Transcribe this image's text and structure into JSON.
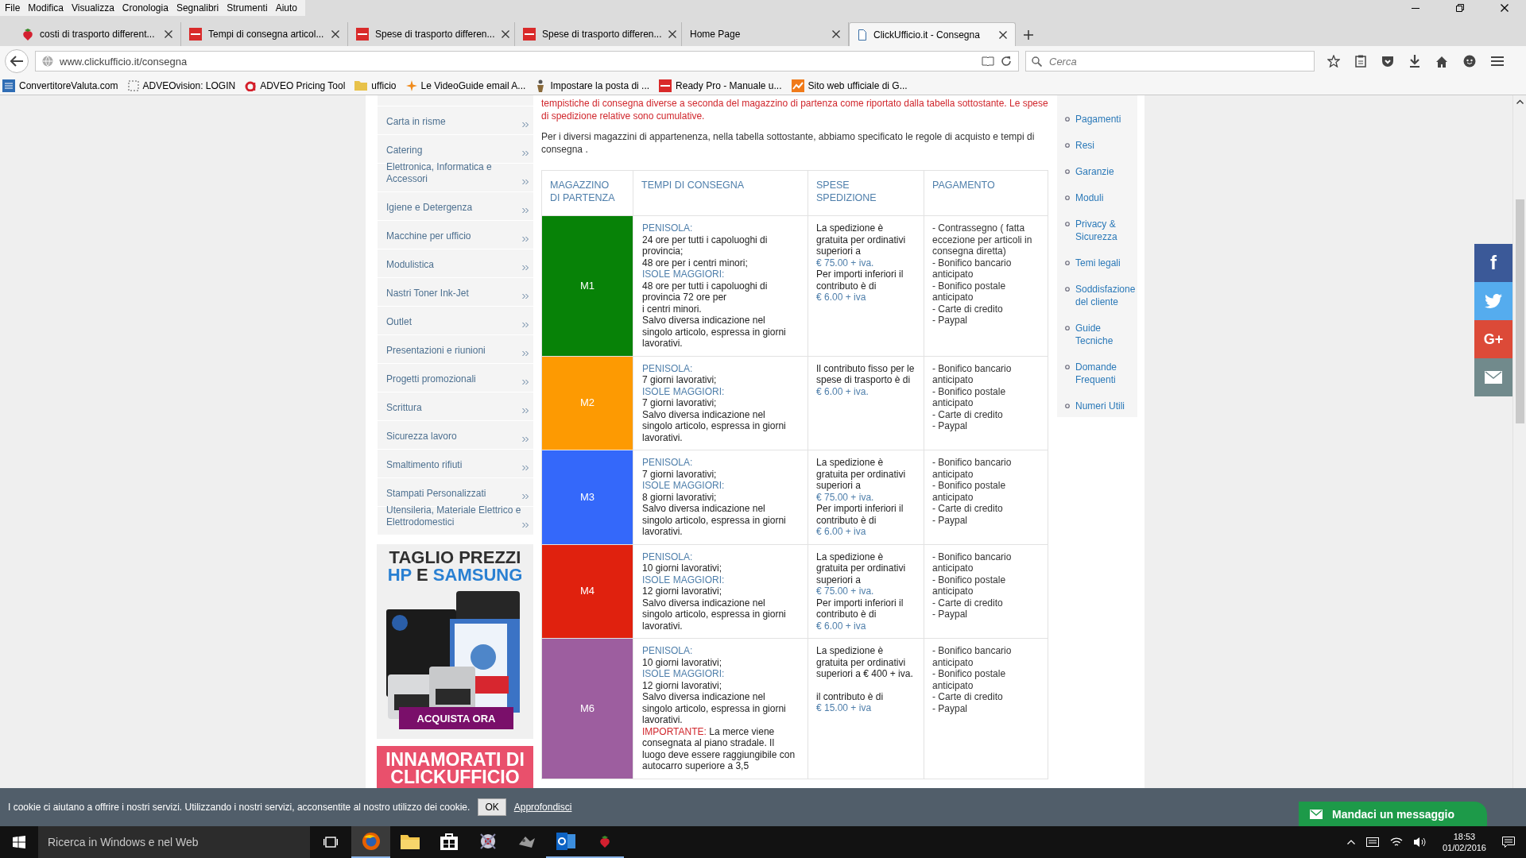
{
  "menu_bar": {
    "items": [
      "File",
      "Modifica",
      "Visualizza",
      "Cronologia",
      "Segnalibri",
      "Strumenti",
      "Aiuto"
    ]
  },
  "tabs": [
    {
      "title": "costi di trasporto different...",
      "selected": false
    },
    {
      "title": "Tempi di consegna articol...",
      "selected": false
    },
    {
      "title": "Spese di trasporto differen...",
      "selected": false
    },
    {
      "title": "Spese di trasporto differen...",
      "selected": false
    },
    {
      "title": "Home Page",
      "selected": false
    },
    {
      "title": "ClickUfficio.it - Consegna",
      "selected": true
    }
  ],
  "address_bar": {
    "url": "www.clickufficio.it/consegna"
  },
  "search_field": {
    "placeholder": "Cerca"
  },
  "bookmarks": [
    {
      "label": "ConvertitoreValuta.com",
      "kind": "link"
    },
    {
      "label": "ADVEOvision: LOGIN",
      "kind": "link"
    },
    {
      "label": "ADVEO Pricing Tool",
      "kind": "link"
    },
    {
      "label": "ufficio",
      "kind": "folder"
    },
    {
      "label": "Le VideoGuide email A...",
      "kind": "link"
    },
    {
      "label": "Impostare la posta di ...",
      "kind": "link"
    },
    {
      "label": "Ready Pro - Manuale u...",
      "kind": "link"
    },
    {
      "label": "Sito web ufficiale di G...",
      "kind": "link"
    }
  ],
  "sidebar": {
    "items": [
      "Carta in risme",
      "Catering",
      "Elettronica, Informatica e Accessori",
      "Igiene e Detergenza",
      "Macchine per ufficio",
      "Modulistica",
      "Nastri Toner Ink-Jet",
      "Outlet",
      "Presentazioni e riunioni",
      "Progetti promozionali",
      "Scrittura",
      "Sicurezza lavoro",
      "Smaltimento rifiuti",
      "Stampati Personalizzati",
      "Utensileria, Materiale Elettrico e Elettrodomestici"
    ]
  },
  "ad": {
    "headline": "TAGLIO PREZZI",
    "brands": [
      {
        "text": "HP",
        "kind": "brand"
      },
      {
        "text": "E",
        "kind": "plain"
      },
      {
        "text": "SAMSUNG",
        "kind": "brand"
      }
    ],
    "button": "ACQUISTA ORA"
  },
  "banner": {
    "lines": [
      "INNAMORATI DI",
      "CLICKUFFICIO"
    ]
  },
  "intro": {
    "notice": "tempistiche di consegna diverse a seconda del magazzino di partenza come riportato dalla tabella sottostante. Le spese di spedizione relative sono cumulative.",
    "text": "Per i diversi magazzini di appartenenza, nella tabella sottostante, abbiamo specificato le regole di acquisto e tempi di consegna ."
  },
  "table": {
    "columns": [
      "MAGAZZINO DI PARTENZA",
      "TEMPI DI CONSEGNA",
      "SPESE SPEDIZIONE",
      "PAGAMENTO"
    ],
    "rows": [
      {
        "code": "M1",
        "color": "#078207",
        "delivery": [
          {
            "kind": "region",
            "text": "PENISOLA:"
          },
          {
            "kind": "text",
            "text": "24 ore per tutti i capoluoghi di provincia;"
          },
          {
            "kind": "text",
            "text": "48 ore per i centri minori;"
          },
          {
            "kind": "region",
            "text": "ISOLE MAGGIORI:"
          },
          {
            "kind": "text",
            "text": "48 ore per tutti i capoluoghi di provincia 72 ore per"
          },
          {
            "kind": "text",
            "text": "i centri minori."
          },
          {
            "kind": "text",
            "text": "Salvo diversa indicazione nel singolo articolo, espressa in giorni lavorativi."
          }
        ],
        "shipping": [
          {
            "kind": "text",
            "text": "La spedizione è gratuita per ordinativi superiori a"
          },
          {
            "kind": "price",
            "text": "€ 75.00 + iva."
          },
          {
            "kind": "text",
            "text": "Per importi inferiori il contributo è di"
          },
          {
            "kind": "price",
            "text": "€ 6.00 + iva"
          }
        ],
        "payment": [
          "- Contrassegno ( fatta eccezione per articoli in consegna diretta)",
          "- Bonifico bancario anticipato",
          "- Bonifico postale anticipato",
          "- Carte di credito",
          "- Paypal"
        ]
      },
      {
        "code": "M2",
        "color": "#fd9a02",
        "delivery": [
          {
            "kind": "region",
            "text": "PENISOLA:"
          },
          {
            "kind": "text",
            "text": "7 giorni lavorativi;"
          },
          {
            "kind": "region",
            "text": "ISOLE MAGGIORI:"
          },
          {
            "kind": "text",
            "text": "7 giorni lavorativi;"
          },
          {
            "kind": "text",
            "text": "Salvo diversa indicazione nel singolo articolo, espressa in giorni lavorativi."
          }
        ],
        "shipping": [
          {
            "kind": "text",
            "text": "Il contributo fisso per le spese di trasporto è di"
          },
          {
            "kind": "price",
            "text": "€ 6.00 + iva."
          }
        ],
        "payment": [
          "- Bonifico bancario anticipato",
          "- Bonifico postale anticipato",
          "- Carte di credito",
          "- Paypal"
        ]
      },
      {
        "code": "M3",
        "color": "#3468fa",
        "delivery": [
          {
            "kind": "region",
            "text": "PENISOLA:"
          },
          {
            "kind": "text",
            "text": "7 giorni lavorativi;"
          },
          {
            "kind": "region",
            "text": "ISOLE MAGGIORI:"
          },
          {
            "kind": "text",
            "text": "8 giorni lavorativi;"
          },
          {
            "kind": "text",
            "text": "Salvo diversa indicazione nel singolo articolo, espressa in giorni lavorativi."
          }
        ],
        "shipping": [
          {
            "kind": "text",
            "text": "La spedizione è gratuita per ordinativi superiori a"
          },
          {
            "kind": "price",
            "text": "€ 75.00 + iva."
          },
          {
            "kind": "text",
            "text": "Per importi inferiori il contributo è di"
          },
          {
            "kind": "price",
            "text": "€ 6.00 + iva"
          }
        ],
        "payment": [
          "- Bonifico bancario anticipato",
          "- Bonifico postale anticipato",
          "- Carte di credito",
          "- Paypal"
        ]
      },
      {
        "code": "M4",
        "color": "#e0210e",
        "delivery": [
          {
            "kind": "region",
            "text": "PENISOLA:"
          },
          {
            "kind": "text",
            "text": "10 giorni lavorativi;"
          },
          {
            "kind": "region",
            "text": "ISOLE MAGGIORI:"
          },
          {
            "kind": "text",
            "text": "12 giorni lavorativi;"
          },
          {
            "kind": "text",
            "text": "Salvo diversa indicazione nel singolo articolo, espressa in giorni lavorativi."
          }
        ],
        "shipping": [
          {
            "kind": "text",
            "text": "La spedizione è gratuita per ordinativi superiori a"
          },
          {
            "kind": "price",
            "text": "€ 75.00 + iva."
          },
          {
            "kind": "text",
            "text": "Per importi inferiori il contributo è di"
          },
          {
            "kind": "price",
            "text": "€ 6.00 + iva"
          }
        ],
        "payment": [
          "- Bonifico bancario anticipato",
          "- Bonifico postale anticipato",
          "- Carte di credito",
          "- Paypal"
        ]
      },
      {
        "code": "M6",
        "color": "#9d5e9f",
        "delivery": [
          {
            "kind": "region",
            "text": "PENISOLA:"
          },
          {
            "kind": "text",
            "text": "10 giorni lavorativi;"
          },
          {
            "kind": "region",
            "text": "ISOLE MAGGIORI:"
          },
          {
            "kind": "text",
            "text": "12 giorni lavorativi;"
          },
          {
            "kind": "text",
            "text": "Salvo diversa indicazione nel singolo articolo, espressa in giorni lavorativi."
          },
          {
            "kind": "note",
            "label": "IMPORTANTE:",
            "text": " La merce viene consegnata al piano stradale. Il luogo deve essere raggiungibile con autocarro superiore a 3,5"
          }
        ],
        "shipping": [
          {
            "kind": "text",
            "text": "La spedizione è gratuita per ordinativi superiori a € 400 + iva."
          },
          {
            "kind": "paragraph",
            "text": "il contributo è di"
          },
          {
            "kind": "price",
            "text": "€ 15.00 + iva"
          }
        ],
        "payment": [
          "- Bonifico bancario anticipato",
          "- Bonifico postale anticipato",
          "- Carte di credito",
          "- Paypal"
        ]
      }
    ]
  },
  "side_nav": {
    "items": [
      "Pagamenti",
      "Resi",
      "Garanzie",
      "Moduli",
      "Privacy & Sicurezza",
      "Temi legali",
      "Soddisfazione del cliente",
      "Guide Tecniche",
      "Domande Frequenti",
      "Numeri Utili"
    ]
  },
  "share_buttons": [
    {
      "kind": "facebook",
      "glyph": "f"
    },
    {
      "kind": "twitter"
    },
    {
      "kind": "googleplus",
      "glyph": "G+"
    },
    {
      "kind": "email"
    }
  ],
  "cookie_bar": {
    "text": "I cookie ci aiutano a offrire i nostri servizi. Utilizzando i nostri servizi, acconsentite al nostro utilizzo dei cookie.",
    "ok": "OK",
    "link": "Approfondisci"
  },
  "chat_button": {
    "label": "Mandaci un messaggio"
  },
  "taskbar": {
    "search_placeholder": "Ricerca in Windows e nel Web",
    "apps": [
      {
        "running": true,
        "selected": true
      },
      {
        "running": false,
        "selected": false
      },
      {
        "running": false,
        "selected": false
      },
      {
        "running": false,
        "selected": false
      },
      {
        "running": false,
        "selected": false
      },
      {
        "running": true,
        "selected": false
      },
      {
        "running": true,
        "selected": false
      }
    ],
    "time": "18:53",
    "date": "01/02/2016"
  }
}
